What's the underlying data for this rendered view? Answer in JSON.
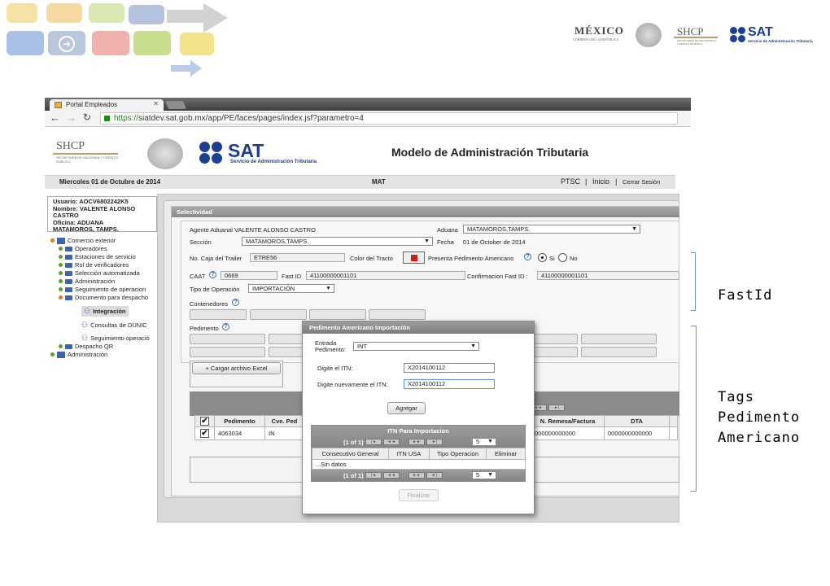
{
  "slide_logos": {
    "mexico": "MÉXICO",
    "mexico_sub": "GOBIERNO DE LA REPÚBLICA",
    "shcp": "SHCP",
    "shcp_sub": "SECRETARÍA DE HACIENDA Y CRÉDITO PÚBLICO",
    "sat": "SAT",
    "sat_sub": "Servicio de Administración Tributaria"
  },
  "browser": {
    "tab_title": "Portal Empleados",
    "url_scheme": "https://",
    "url_rest": "siatdev.sat.gob.mx/app/PE/faces/pages/index.jsf?parametro=4"
  },
  "page_header": {
    "shcp": "SHCP",
    "shcp_sub": "SECRETARÍA DE HACIENDA Y CRÉDITO PÚBLICO",
    "sat": "SAT",
    "sat_sub": "Servicio de Administración Tributaria",
    "title": "Modelo de Administración Tributaria"
  },
  "datebar": {
    "date": "Miercoles 01 de Octubre de 2014",
    "center": "MAT",
    "ptsc": "PTSC",
    "inicio": "Inicio",
    "cerrar": "Cerrar Sesión"
  },
  "user": {
    "line1": "Usuario: AOCV6802242K5",
    "line2": "Nombre: VALENTE ALONSO",
    "line3": "CASTRO",
    "line4": "Oficina:  ADUANA",
    "line5": "MATAMOROS, TAMPS."
  },
  "tree": [
    "Comercio exterior",
    "Operadores",
    "Estaciones de servicio",
    "Rol de verificadores",
    "Selección automatizada",
    "Administración",
    "Seguimiento de operacion",
    "Documento para despacho",
    "Integración",
    "Consultas de DUNIC",
    "Seguimiento operació",
    "Despacho QR",
    "Administración"
  ],
  "form": {
    "header": "Selectividad",
    "agente": "Agente Aduanal VALENTE ALONSO CASTRO",
    "aduana_label": "Aduana",
    "aduana_value": "MATAMOROS,TAMPS.",
    "seccion_label": "Sección",
    "seccion_value": "MATAMOROS,TAMPS.",
    "fecha_label": "Fecha",
    "fecha_value": "01 de October de 2014",
    "caja_label": "No. Caja del Trailer",
    "caja_value": "ETRE56",
    "color_label": "Color del Tracto",
    "presenta_label": "Presenta Pedimento Americano",
    "si": "Si",
    "no": "No",
    "caat_label": "CAAT",
    "caat_value": "0669",
    "fastid_label": "Fast ID",
    "fastid_value": "41100000001101",
    "confirm_label": "Confirmacion Fast ID :",
    "confirm_value": "41100000001101",
    "tipo_label": "Tipo de Operación",
    "tipo_value": "IMPORTACIÓN",
    "contenedores_label": "Contenedores",
    "pedimento_label": "Pedimento",
    "cargar_btn": "Cargar archivo Excel"
  },
  "grid": {
    "headers": [
      "Pedimento",
      "Cve. Ped",
      "N. Remesa/Factura",
      "DTA"
    ],
    "row": [
      "4063034",
      "IN",
      "000000000000",
      "0000000000000"
    ]
  },
  "dialog": {
    "title": "Pedimento Americano Importación",
    "entrada_label": "Entrada Pedimento:",
    "entrada_value": "INT",
    "itn_label": "Digite el ITN:",
    "itn_value": "X2014100112",
    "itn2_label": "Digite nuevamente el ITN:",
    "itn2_value": "X2014100112",
    "agregar": "Agregar",
    "itn_panel_title": "ITN Para Importacion",
    "pager_text": "(1 of 1)",
    "pager_size": "5",
    "columns": [
      "Consecutivo General",
      "ITN USA",
      "Tipo Operacion",
      "Eliminar"
    ],
    "empty": "...Sin datos",
    "finalizar": "Finalizar"
  },
  "annotations": {
    "fastid": "FastId",
    "tags_1": "Tags",
    "tags_2": "Pedimento",
    "tags_3": "Americano"
  },
  "colors": {
    "sat_blue": "#1d3f8f",
    "tracto_red": "#d11a1a",
    "bracket": "#6e94c4"
  }
}
